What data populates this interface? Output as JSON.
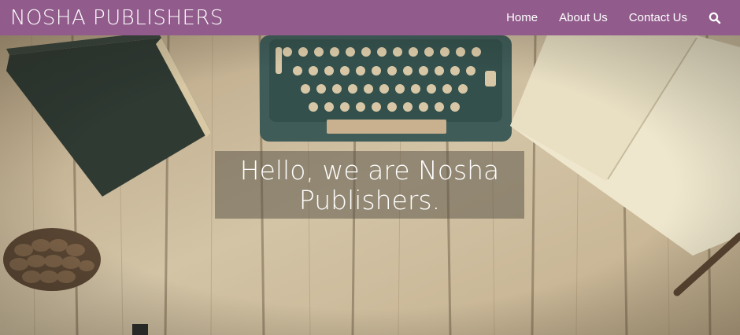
{
  "header": {
    "logo": "NOSHA PUBLISHERS",
    "nav": [
      {
        "label": "Home"
      },
      {
        "label": "About Us"
      },
      {
        "label": "Contact Us"
      }
    ],
    "search_icon": "search-icon"
  },
  "hero": {
    "title": "Hello, we are Nosha Publishers."
  },
  "colors": {
    "header_bg": "#915c8c",
    "text": "#ffffff"
  }
}
